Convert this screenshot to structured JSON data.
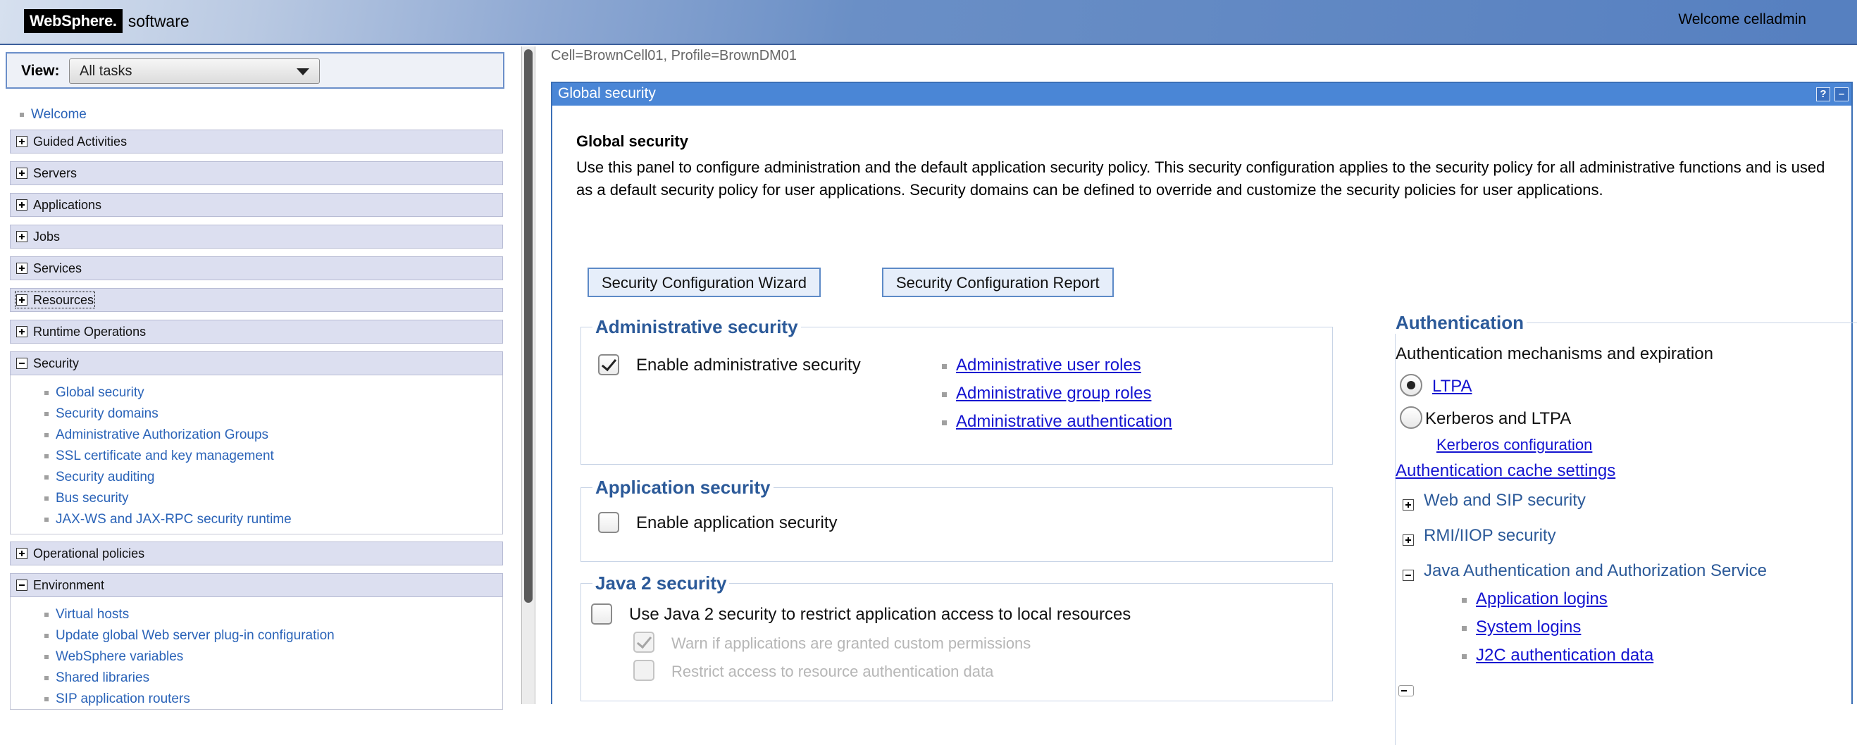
{
  "banner": {
    "brand": "WebSphere.",
    "brand_suffix": "software",
    "welcome": "Welcome celladmin"
  },
  "nav": {
    "view_label": "View:",
    "view_value": "All tasks",
    "welcome": "Welcome",
    "categories": {
      "guided": "Guided Activities",
      "servers": "Servers",
      "applications": "Applications",
      "jobs": "Jobs",
      "services": "Services",
      "resources": "Resources",
      "runtime": "Runtime Operations",
      "security": "Security",
      "operational": "Operational policies",
      "environment": "Environment"
    },
    "security_items": [
      "Global security",
      "Security domains",
      "Administrative Authorization Groups",
      "SSL certificate and key management",
      "Security auditing",
      "Bus security",
      "JAX-WS and JAX-RPC security runtime"
    ],
    "environment_items": [
      "Virtual hosts",
      "Update global Web server plug-in configuration",
      "WebSphere variables",
      "Shared libraries",
      "SIP application routers"
    ]
  },
  "main": {
    "breadcrumb": "Cell=BrownCell01, Profile=BrownDM01",
    "panel_title": "Global security",
    "help_icon": "?",
    "min_icon": "–",
    "heading": "Global security",
    "description": "Use this panel to configure administration and the default application security policy. This security configuration applies to the security policy for all administrative functions and is used as a default security policy for user applications. Security domains can be defined to override and customize the security policies for user applications.",
    "wizard_button": "Security Configuration Wizard",
    "report_button": "Security Configuration Report",
    "admin_security": {
      "legend": "Administrative security",
      "enable_label": "Enable administrative security",
      "enabled": true,
      "links": [
        "Administrative user roles",
        "Administrative group roles",
        "Administrative authentication"
      ]
    },
    "app_security": {
      "legend": "Application security",
      "enable_label": "Enable application security",
      "enabled": false
    },
    "java2_security": {
      "legend": "Java 2 security",
      "use_label": "Use Java 2 security to restrict application access to local resources",
      "warn_label": "Warn if applications are granted custom permissions",
      "restrict_label": "Restrict access to resource authentication data"
    },
    "authentication": {
      "legend": "Authentication",
      "mechanisms_label": "Authentication mechanisms and expiration",
      "ltpa": "LTPA",
      "kerberos": "Kerberos and LTPA",
      "kerberos_config": "Kerberos configuration",
      "cache_settings": "Authentication cache settings",
      "web_sip": "Web and SIP security",
      "rmi_iiop": "RMI/IIOP security",
      "jaas": "Java Authentication and Authorization Service",
      "jaas_links": [
        "Application logins",
        "System logins",
        "J2C authentication data"
      ]
    }
  },
  "colors": {
    "accent": "#4a86d6",
    "link": "#1414d0",
    "nav_link": "#2a63b8",
    "legend": "#2c5a99"
  }
}
